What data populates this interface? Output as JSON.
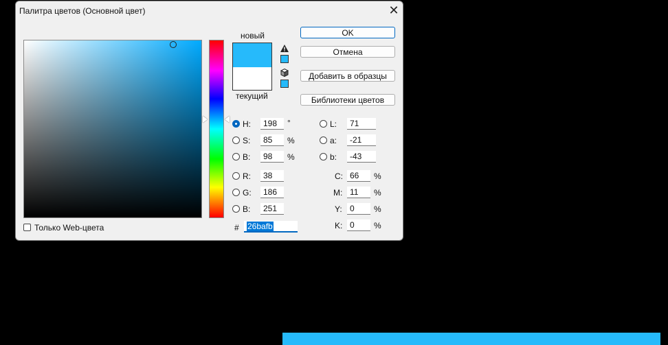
{
  "dialog": {
    "title": "Палитра цветов (Основной цвет)",
    "close_glyph": "✕"
  },
  "colors": {
    "new": "#26bafb",
    "current": "#ffffff",
    "hue_base": "#00aaff",
    "accent": "#0067c0"
  },
  "swatch": {
    "new_label": "новый",
    "current_label": "текущий"
  },
  "buttons": {
    "ok": "OK",
    "cancel": "Отмена",
    "add_to_swatches": "Добавить в образцы",
    "color_libraries": "Библиотеки цветов"
  },
  "hsb": [
    {
      "label": "H:",
      "value": "198",
      "unit": "°",
      "selected": true
    },
    {
      "label": "S:",
      "value": "85",
      "unit": "%",
      "selected": false
    },
    {
      "label": "B:",
      "value": "98",
      "unit": "%",
      "selected": false
    }
  ],
  "rgb": [
    {
      "label": "R:",
      "value": "38"
    },
    {
      "label": "G:",
      "value": "186"
    },
    {
      "label": "B:",
      "value": "251"
    }
  ],
  "lab": [
    {
      "label": "L:",
      "value": "71"
    },
    {
      "label": "a:",
      "value": "-21"
    },
    {
      "label": "b:",
      "value": "-43"
    }
  ],
  "cmyk": [
    {
      "label": "C:",
      "value": "66",
      "unit": "%"
    },
    {
      "label": "M:",
      "value": "11",
      "unit": "%"
    },
    {
      "label": "Y:",
      "value": "0",
      "unit": "%"
    },
    {
      "label": "K:",
      "value": "0",
      "unit": "%"
    }
  ],
  "hex": {
    "label": "#",
    "value": "26bafb"
  },
  "web_only": {
    "label": "Только Web-цвета",
    "checked": false
  },
  "icons": {
    "gamut_warning": "warning-triangle-icon",
    "web_safe": "cube-icon"
  }
}
